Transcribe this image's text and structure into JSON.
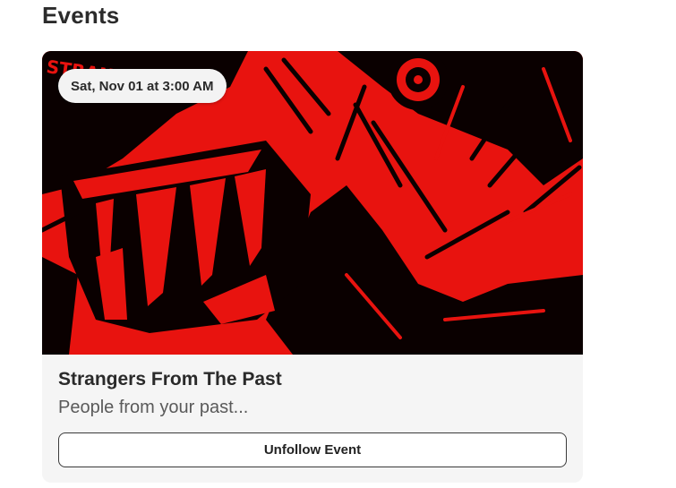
{
  "section": {
    "title": "Events"
  },
  "event": {
    "date_label": "Sat, Nov 01 at 3:00 AM",
    "title": "Strangers From The Past",
    "description": "People from your past...",
    "image_text": "STRANGERS PAST",
    "unfollow_label": "Unfollow Event"
  },
  "colors": {
    "image_red": "#e8130f",
    "image_black": "#0a0000",
    "card_background": "#f5f5f5"
  }
}
